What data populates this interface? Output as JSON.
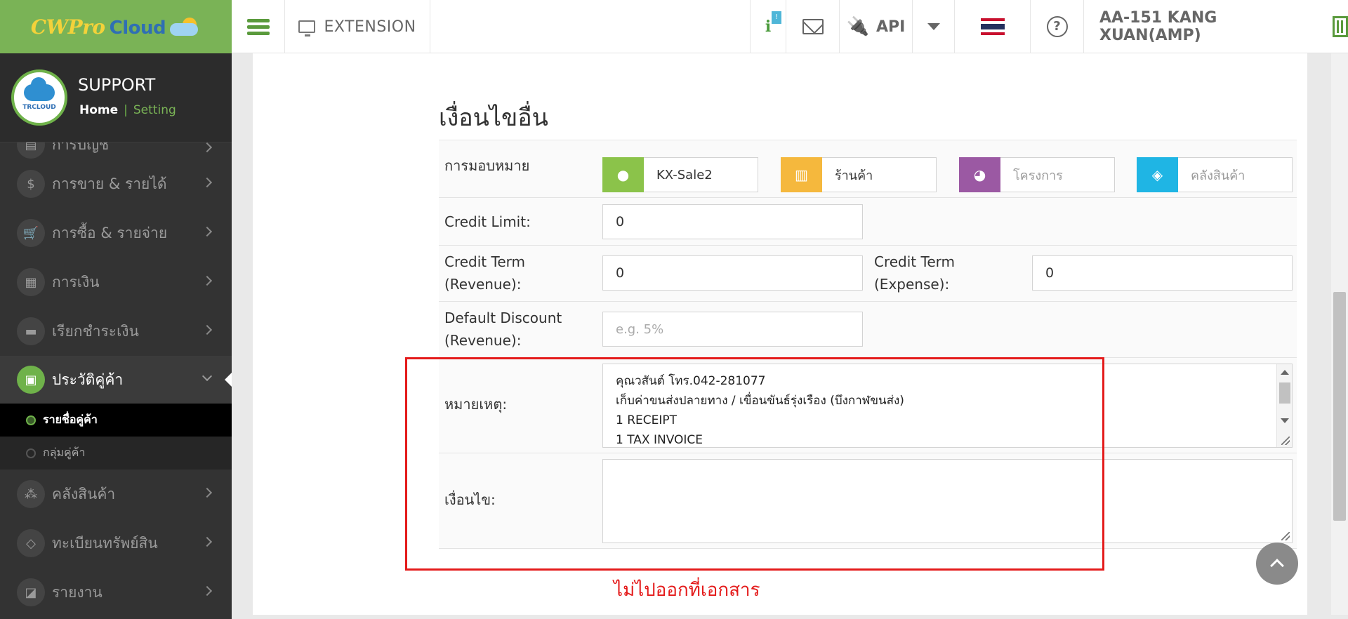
{
  "header": {
    "logo_main": "CWPro",
    "logo_cloud": "Cloud",
    "extension_label": "EXTENSION",
    "info_badge": "!",
    "api_label": "API",
    "user_label": "AA-151 KANG XUAN(AMP)"
  },
  "profile": {
    "avatar_text": "TRCLOUD",
    "title": "SUPPORT",
    "home": "Home",
    "separator": "|",
    "setting": "Setting"
  },
  "sidebar": {
    "partial_item": "การบัญชี",
    "items": [
      {
        "label": "การขาย & รายได้",
        "icon": "dollar-icon",
        "glyph": "$"
      },
      {
        "label": "การซื้อ & รายจ่าย",
        "icon": "cart-icon",
        "glyph": "🛒"
      },
      {
        "label": "การเงิน",
        "icon": "calendar-icon",
        "glyph": "▦"
      },
      {
        "label": "เรียกชำระเงิน",
        "icon": "card-icon",
        "glyph": "▬"
      }
    ],
    "active_item": {
      "label": "ประวัติคู่ค้า",
      "icon": "contact-book-icon",
      "glyph": "▣"
    },
    "sub_items": [
      {
        "label": "รายชื่อคู่ค้า",
        "active": true
      },
      {
        "label": "กลุ่มคู่ค้า",
        "active": false
      }
    ],
    "items_after": [
      {
        "label": "คลังสินค้า",
        "icon": "cubes-icon",
        "glyph": "⁂"
      },
      {
        "label": "ทะเบียนทรัพย์สิน",
        "icon": "diamond-icon",
        "glyph": "◇"
      },
      {
        "label": "รายงาน",
        "icon": "report-icon",
        "glyph": "◪"
      }
    ]
  },
  "form": {
    "section_title": "เงื่อนไขอื่น",
    "assign_label": "การมอบหมาย",
    "assignments": [
      {
        "value": "KX-Sale2",
        "placeholder": false,
        "color": "#8bc34a",
        "icon": "user-icon"
      },
      {
        "value": "ร้านค้า",
        "placeholder": false,
        "color": "#f5b83d",
        "icon": "building-icon"
      },
      {
        "value": "โครงการ",
        "placeholder": true,
        "color": "#9b59a3",
        "icon": "pie-chart-icon"
      },
      {
        "value": "คลังสินค้า",
        "placeholder": true,
        "color": "#1fb5e4",
        "icon": "box-icon"
      }
    ],
    "credit_limit_label": "Credit Limit:",
    "credit_limit_value": "0",
    "credit_term_rev_label_1": "Credit Term",
    "credit_term_rev_label_2": "(Revenue):",
    "credit_term_rev_value": "0",
    "credit_term_exp_label_1": "Credit Term",
    "credit_term_exp_label_2": "(Expense):",
    "credit_term_exp_value": "0",
    "default_discount_label_1": "Default Discount",
    "default_discount_label_2": "(Revenue):",
    "default_discount_placeholder": "e.g. 5%",
    "remark_label": "หมายเหตุ:",
    "remark_lines": [
      "คุณวสันต์ โทร.042-281077",
      "เก็บค่าขนส่งปลายทาง / เขื่อนขันธ์รุ่งเรือง (บึงกาฬขนส่ง)",
      "1 RECEIPT",
      "1 TAX INVOICE"
    ],
    "condition_label": "เงื่อนไข:",
    "condition_value": ""
  },
  "annotation": {
    "text": "ไม่ไปออกที่เอกสาร",
    "color": "#e41b1b"
  },
  "colors": {
    "brand_green": "#7ab356",
    "sidebar_bg": "#333333",
    "highlight": "#e41b1b"
  }
}
